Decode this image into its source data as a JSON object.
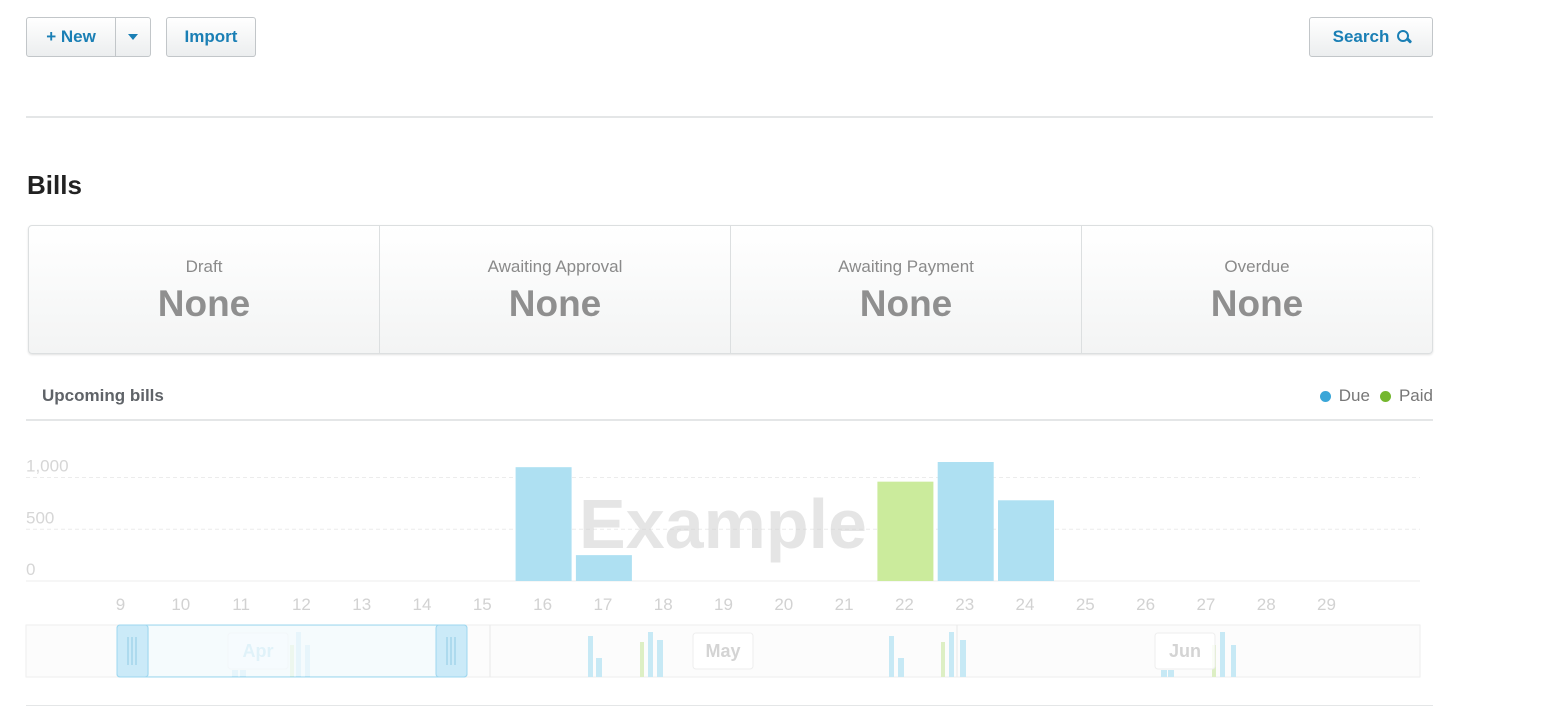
{
  "toolbar": {
    "new_label": "+ New",
    "import_label": "Import",
    "search_label": "Search"
  },
  "page": {
    "title": "Bills"
  },
  "summary": [
    {
      "label": "Draft",
      "value": "None"
    },
    {
      "label": "Awaiting Approval",
      "value": "None"
    },
    {
      "label": "Awaiting Payment",
      "value": "None"
    },
    {
      "label": "Overdue",
      "value": "None"
    }
  ],
  "upcoming": {
    "title": "Upcoming bills",
    "legend": [
      {
        "name": "Due",
        "color": "#3aa6d8"
      },
      {
        "name": "Paid",
        "color": "#74b72e"
      }
    ],
    "watermark": "Example"
  },
  "chart_data": {
    "type": "bar",
    "categories": [
      "9",
      "10",
      "11",
      "12",
      "13",
      "14",
      "15",
      "16",
      "17",
      "18",
      "19",
      "20",
      "21",
      "22",
      "23",
      "24",
      "25",
      "26",
      "27",
      "28",
      "29"
    ],
    "series": [
      {
        "name": "Due",
        "color": "#aee0f2",
        "values": [
          0,
          0,
          0,
          0,
          0,
          0,
          0,
          1100,
          250,
          0,
          0,
          0,
          0,
          0,
          1150,
          780,
          0,
          0,
          0,
          0,
          0
        ]
      },
      {
        "name": "Paid",
        "color": "#cbeb9c",
        "values": [
          0,
          0,
          0,
          0,
          0,
          0,
          0,
          0,
          0,
          0,
          0,
          0,
          0,
          960,
          0,
          0,
          0,
          0,
          0,
          0,
          0
        ]
      }
    ],
    "yticks": [
      0,
      500,
      1000
    ],
    "ytick_labels": [
      "0",
      "500",
      "1,000"
    ],
    "ylim": [
      0,
      1150
    ],
    "grid": true,
    "legend": "top-right"
  },
  "navigator": {
    "months": [
      "Apr",
      "May",
      "Jun"
    ]
  }
}
